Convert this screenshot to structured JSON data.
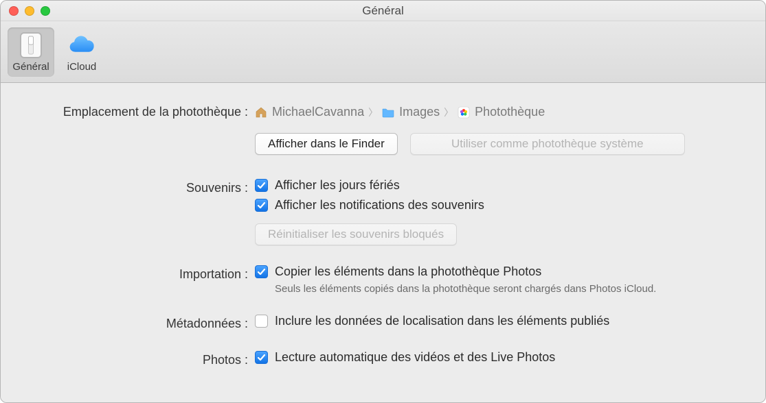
{
  "window": {
    "title": "Général"
  },
  "tabs": {
    "general": "Général",
    "icloud": "iCloud"
  },
  "location": {
    "label": "Emplacement de la photothèque :",
    "crumbs": [
      "MichaelCavanna",
      "Images",
      "Photothèque"
    ],
    "show_in_finder": "Afficher dans le Finder",
    "use_as_system": "Utiliser comme photothèque système"
  },
  "souvenirs": {
    "label": "Souvenirs :",
    "holidays": "Afficher les jours fériés",
    "notifications": "Afficher les notifications des souvenirs",
    "reset_blocked": "Réinitialiser les souvenirs bloqués"
  },
  "importation": {
    "label": "Importation :",
    "copy": "Copier les éléments dans la photothèque Photos",
    "hint": "Seuls les éléments copiés dans la photothèque seront chargés dans Photos iCloud."
  },
  "metadonnees": {
    "label": "Métadonnées :",
    "include": "Inclure les données de localisation dans les éléments publiés"
  },
  "photos": {
    "label": "Photos :",
    "autoplay": "Lecture automatique des vidéos et des Live Photos"
  }
}
